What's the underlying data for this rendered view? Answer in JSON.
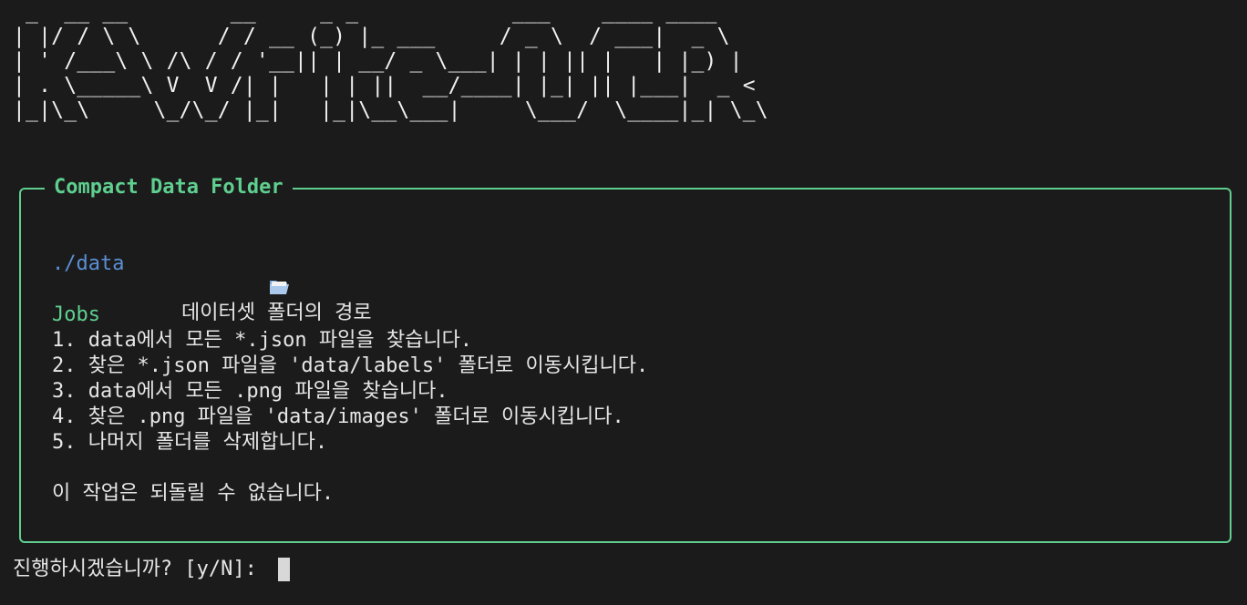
{
  "banner": {
    "ascii_art": " _  __ __        __     _ _            ___    ____ ____  \n| |/ / \\ \\      / / __ (_) |_ ___     / _ \\  / ___|  _ \\ \n| ' /___\\ \\ /\\ / / '__|| | __/ _ \\___| | | || |   | |_) |\n| . \\_____\\ V  V /| |   | | ||  __/____| |_| || |___|  _ < \n|_|\\_\\     \\_/\\_/ |_|   |_|\\__\\___|     \\___/  \\____|_| \\_\\"
  },
  "panel": {
    "title": "Compact Data Folder",
    "folder_icon": "open-folder-icon",
    "path_label": "데이터셋 폴더의 경로",
    "path_value": "./data",
    "jobs_heading": "Jobs",
    "jobs": [
      "1. data에서 모든 *.json 파일을 찾습니다.",
      "2. 찾은 *.json 파일을 'data/labels' 폴더로 이동시킵니다.",
      "3. data에서 모든 .png 파일을 찾습니다.",
      "4. 찾은 .png 파일을 'data/images' 폴더로 이동시킵니다.",
      "5. 나머지 폴더를 삭제합니다."
    ],
    "warning": "이 작업은 되돌릴 수 없습니다."
  },
  "prompt": {
    "text": "진행하시겠습니까? [y/N]: "
  },
  "colors": {
    "background": "#1b1b1b",
    "accent_green": "#5fcf8f",
    "path_blue": "#5b8fd6",
    "text": "#e6e6e6"
  }
}
